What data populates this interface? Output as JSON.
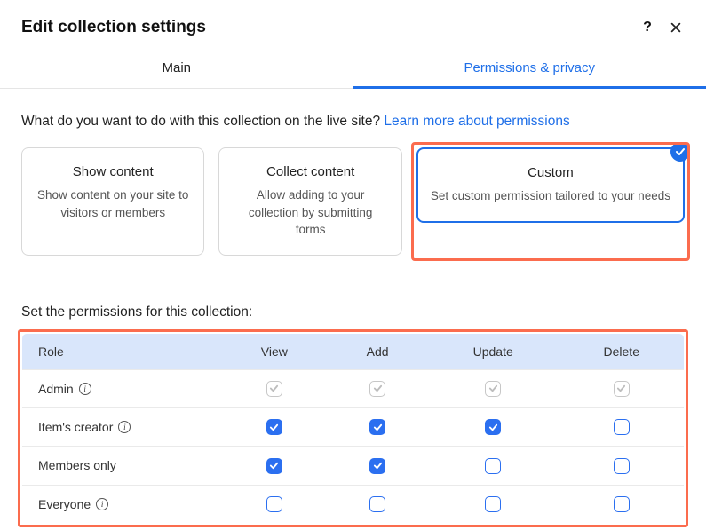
{
  "header": {
    "title": "Edit collection settings"
  },
  "tabs": {
    "main": "Main",
    "permissions": "Permissions & privacy"
  },
  "question": {
    "text": "What do you want to do with this collection on the live site? ",
    "link": "Learn more about permissions"
  },
  "cards": {
    "show": {
      "title": "Show content",
      "desc": "Show content on your site to visitors or members"
    },
    "collect": {
      "title": "Collect content",
      "desc": "Allow adding to your collection by submitting forms"
    },
    "custom": {
      "title": "Custom",
      "desc": "Set custom permission tailored to your needs"
    }
  },
  "permissions": {
    "heading": "Set the permissions for this collection:",
    "columns": {
      "role": "Role",
      "view": "View",
      "add": "Add",
      "update": "Update",
      "delete": "Delete"
    },
    "rows": [
      {
        "role": "Admin",
        "info": true,
        "cells": [
          "locked",
          "locked",
          "locked",
          "locked"
        ]
      },
      {
        "role": "Item's creator",
        "info": true,
        "cells": [
          "checked",
          "checked",
          "checked",
          "empty"
        ]
      },
      {
        "role": "Members only",
        "info": false,
        "cells": [
          "checked",
          "checked",
          "empty",
          "empty"
        ]
      },
      {
        "role": "Everyone",
        "info": true,
        "cells": [
          "empty",
          "empty",
          "empty",
          "empty"
        ]
      }
    ]
  }
}
